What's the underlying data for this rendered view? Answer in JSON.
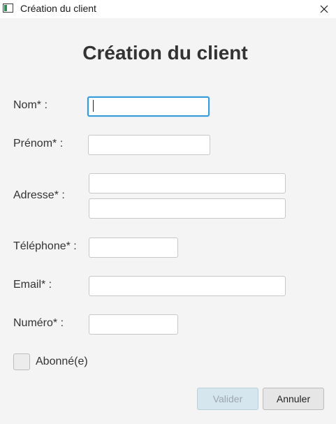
{
  "window": {
    "title": "Création du client"
  },
  "form": {
    "heading": "Création du client",
    "fields": {
      "nom": {
        "label": "Nom* :",
        "value": ""
      },
      "prenom": {
        "label": "Prénom* :",
        "value": ""
      },
      "adresse": {
        "label": "Adresse* :",
        "line1": "",
        "line2": ""
      },
      "telephone": {
        "label": "Téléphone* :",
        "value": ""
      },
      "email": {
        "label": "Email* :",
        "value": ""
      },
      "numero": {
        "label": "Numéro* :",
        "value": ""
      }
    },
    "subscribed": {
      "label": "Abonné(e)",
      "checked": false
    }
  },
  "buttons": {
    "validate": {
      "label": "Valider",
      "enabled": false
    },
    "cancel": {
      "label": "Annuler",
      "enabled": true
    }
  },
  "icons": {
    "app": "app-window-icon",
    "close": "close-icon"
  },
  "colors": {
    "focus_border": "#3a9ad9",
    "disabled_button_bg": "#d6e6ee",
    "disabled_button_text": "#9aa8b0"
  }
}
